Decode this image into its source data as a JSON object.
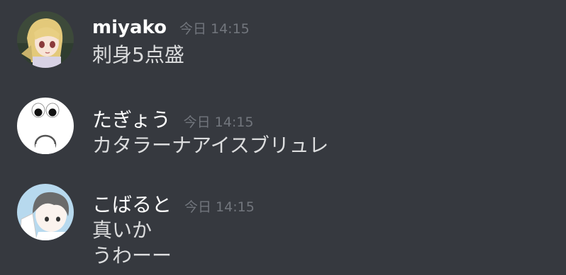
{
  "messages": [
    {
      "username": "miyako",
      "timestamp": "今日 14:15",
      "avatar_icon": "anime-girl-avatar",
      "lines": [
        "刺身5点盛"
      ]
    },
    {
      "username": "たぎょう",
      "timestamp": "今日 14:15",
      "avatar_icon": "shocked-face-avatar",
      "lines": [
        "カタラーナアイスブリュレ"
      ]
    },
    {
      "username": "こばると",
      "timestamp": "今日 14:15",
      "avatar_icon": "anime-boy-avatar",
      "lines": [
        "真いか",
        "うわーー"
      ]
    }
  ],
  "colors": {
    "background": "#36393f",
    "username": "#ffffff",
    "text": "#dcddde",
    "timestamp": "#72767d"
  }
}
